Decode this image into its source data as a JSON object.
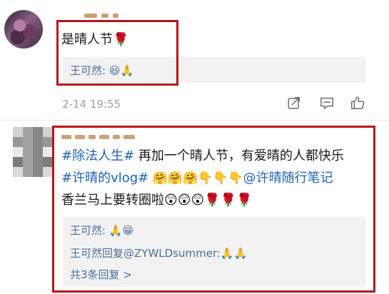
{
  "post1": {
    "text": "是晴人节🌹",
    "reply": "王可然: 😆🙏",
    "timestamp": "2-14 19:55"
  },
  "post2": {
    "line1_hashtag": "#除法人生#",
    "line1_text": " 再加一个晴人节，有爱晴的人都快乐",
    "line2_hashtag": "#许晴的vlog#",
    "line2_emojis": " 🤗🤗🤗👇👇👇",
    "line2_mention": "@许晴随行笔记",
    "line3_text": "香兰马上要转圈啦😲😲😲🌹🌹🌹",
    "replies": [
      "王可然: 🙏😁",
      "王可然回复@ZYWLDsummer:🙏🙏",
      "共3条回复 >"
    ]
  },
  "icons": {
    "share": "share-icon",
    "comment": "comment-icon",
    "like": "like-icon"
  },
  "colors": {
    "highlight_border": "#b8141b",
    "link_blue": "#1b63b7",
    "reply_name_blue": "#4d6f9b",
    "timestamp_gray": "#a0a0a0",
    "panel_bg": "#f2f2f2"
  }
}
